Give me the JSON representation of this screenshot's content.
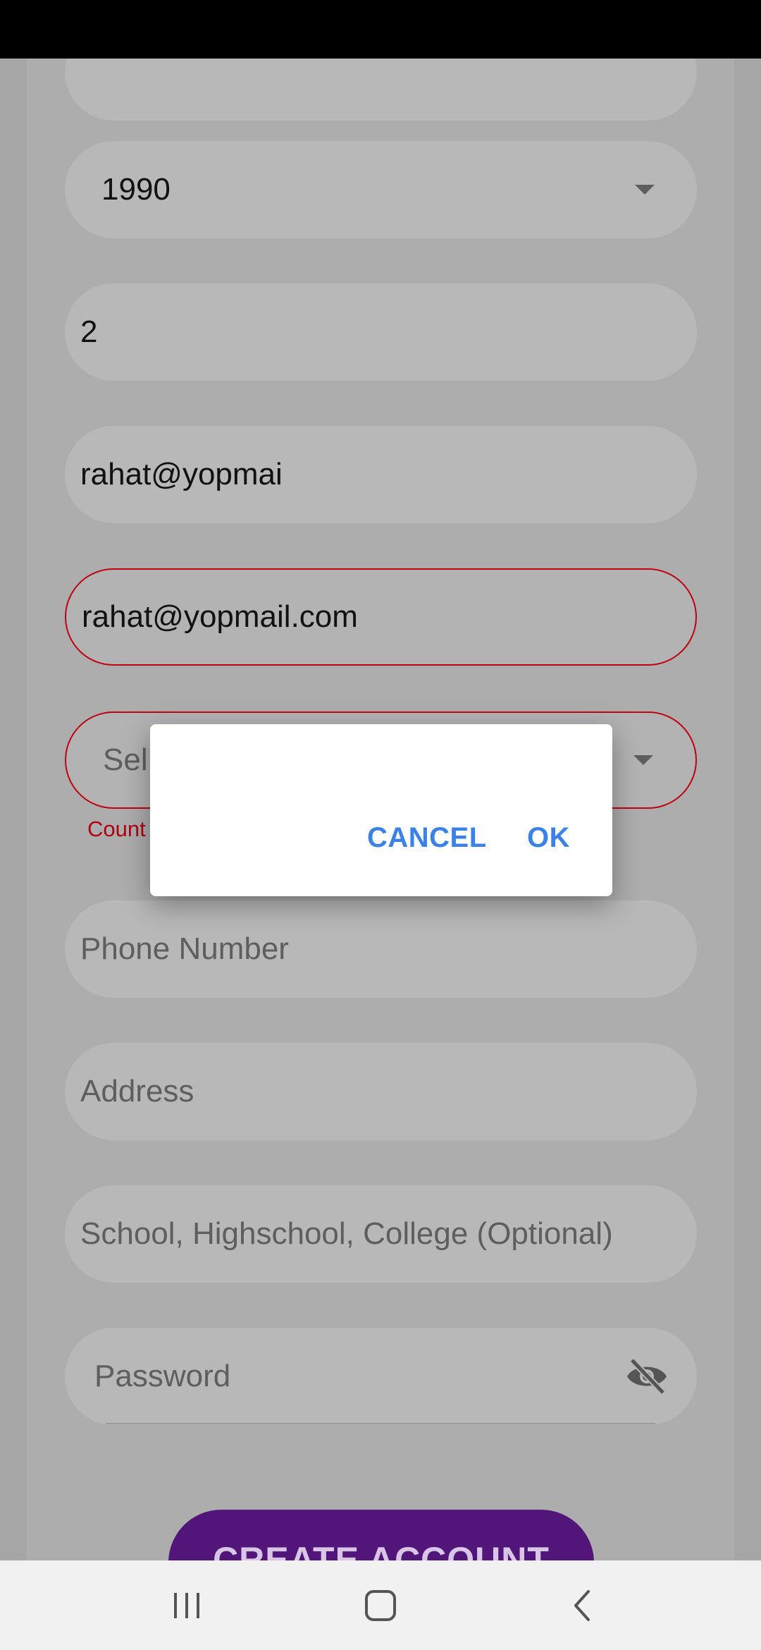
{
  "form": {
    "year_value": "1990",
    "field2_value": "2",
    "email_value": "rahat@yopmai",
    "email_confirm_value": "rahat@yopmail.com",
    "country_placeholder": "Sel",
    "country_error": "Count",
    "phone_placeholder": "Phone Number",
    "address_placeholder": "Address",
    "school_placeholder": "School, Highschool, College (Optional)",
    "password_placeholder": "Password",
    "create_account_label": "CREATE ACCOUNT"
  },
  "dialog": {
    "cancel_label": "CANCEL",
    "ok_label": "OK"
  },
  "colors": {
    "accent": "#3b82e8",
    "error": "#c00010",
    "primary_button": "#521579"
  },
  "icons": [
    "dropdown-caret-icon",
    "visibility-off-icon",
    "recent-apps-icon",
    "home-icon",
    "back-icon"
  ]
}
